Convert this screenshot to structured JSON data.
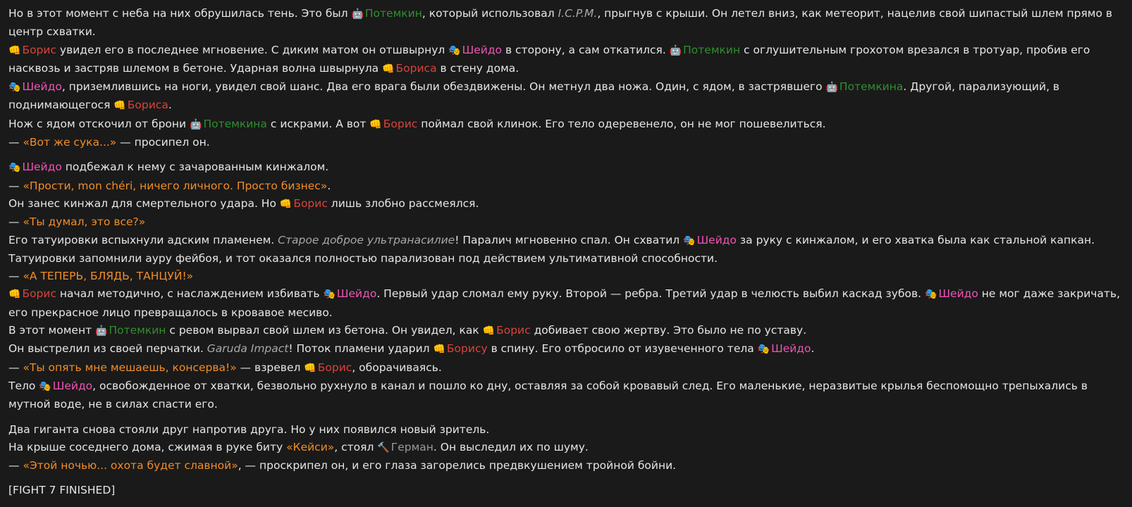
{
  "characters": {
    "potemkin": {
      "icon": "robot-face-icon",
      "emoji": "🤖",
      "color": "#2f8f2f"
    },
    "boris": {
      "icon": "fist-icon",
      "emoji": "👊",
      "color": "#d8433a"
    },
    "sheydo": {
      "icon": "theater-masks-icon",
      "emoji": "🎭",
      "color": "#ee55b4"
    },
    "german": {
      "icon": "hammer-icon",
      "emoji": "🔨",
      "color": "#9a9a9a"
    }
  },
  "quote_color": "#f28c28",
  "paragraphs": [
    {
      "gap": false,
      "segments": [
        {
          "t": "Но в этот момент с неба на них обрушилась тень. Это был "
        },
        {
          "char": "potemkin",
          "name": "Потемкин"
        },
        {
          "t": ", который использовал "
        },
        {
          "it": "I.C.P.M."
        },
        {
          "t": ", прыгнув с крыши. Он летел вниз, как метеорит, нацелив свой шипастый шлем прямо в центр схватки."
        }
      ]
    },
    {
      "gap": false,
      "segments": [
        {
          "char": "boris",
          "name": "Борис"
        },
        {
          "t": " увидел его в последнее мгновение. С диким матом он отшвырнул "
        },
        {
          "char": "sheydo",
          "name": "Шейдо"
        },
        {
          "t": " в сторону, а сам откатился. "
        },
        {
          "char": "potemkin",
          "name": "Потемкин"
        },
        {
          "t": " с оглушительным грохотом врезался в тротуар, пробив его насквозь и застряв шлемом в бетоне. Ударная волна швырнула "
        },
        {
          "char": "boris",
          "name": "Бориса"
        },
        {
          "t": " в стену дома."
        }
      ]
    },
    {
      "gap": false,
      "segments": [
        {
          "char": "sheydo",
          "name": "Шейдо"
        },
        {
          "t": ", приземлившись на ноги, увидел свой шанс. Два его врага были обездвижены. Он метнул два ножа. Один, с ядом, в застрявшего "
        },
        {
          "char": "potemkin",
          "name": "Потемкина"
        },
        {
          "t": ". Другой, парализующий, в поднимающегося "
        },
        {
          "char": "boris",
          "name": "Бориса"
        },
        {
          "t": "."
        }
      ]
    },
    {
      "gap": false,
      "segments": [
        {
          "t": "Нож с ядом отскочил от брони "
        },
        {
          "char": "potemkin",
          "name": "Потемкина"
        },
        {
          "t": " с искрами. А вот "
        },
        {
          "char": "boris",
          "name": "Борис"
        },
        {
          "t": " поймал свой клинок. Его тело одеревенело, он не мог пошевелиться."
        }
      ]
    },
    {
      "gap": false,
      "segments": [
        {
          "t": "— "
        },
        {
          "q": "«Вот же сука...»"
        },
        {
          "t": " — просипел он."
        }
      ]
    },
    {
      "gap": true,
      "segments": [
        {
          "char": "sheydo",
          "name": "Шейдо"
        },
        {
          "t": " подбежал к нему с зачарованным кинжалом."
        }
      ]
    },
    {
      "gap": false,
      "segments": [
        {
          "t": "— "
        },
        {
          "q": "«Прости, mon chéri, ничего личного. Просто бизнес»"
        },
        {
          "t": "."
        }
      ]
    },
    {
      "gap": false,
      "segments": [
        {
          "t": "Он занес кинжал для смертельного удара. Но "
        },
        {
          "char": "boris",
          "name": "Борис"
        },
        {
          "t": " лишь злобно рассмеялся."
        }
      ]
    },
    {
      "gap": false,
      "segments": [
        {
          "t": "— "
        },
        {
          "q": "«Ты думал, это все?»"
        }
      ]
    },
    {
      "gap": false,
      "segments": [
        {
          "t": "Его татуировки вспыхнули адским пламенем. "
        },
        {
          "it": "Старое доброе ультранасилие"
        },
        {
          "t": "! Паралич мгновенно спал. Он схватил "
        },
        {
          "char": "sheydo",
          "name": "Шейдо"
        },
        {
          "t": " за руку с кинжалом, и его хватка была как стальной капкан. Татуировки запомнили ауру фейбоя, и тот оказался полностью парализован под действием ультимативной способности."
        }
      ]
    },
    {
      "gap": false,
      "segments": [
        {
          "t": "— "
        },
        {
          "q": "«А ТЕПЕРЬ, БЛЯДЬ, ТАНЦУЙ!»"
        }
      ]
    },
    {
      "gap": false,
      "segments": [
        {
          "char": "boris",
          "name": "Борис"
        },
        {
          "t": " начал методично, с наслаждением избивать "
        },
        {
          "char": "sheydo",
          "name": "Шейдо"
        },
        {
          "t": ". Первый удар сломал ему руку. Второй — ребра. Третий удар в челюсть выбил каскад зубов. "
        },
        {
          "char": "sheydo",
          "name": "Шейдо"
        },
        {
          "t": " не мог даже закричать, его прекрасное лицо превращалось в кровавое месиво."
        }
      ]
    },
    {
      "gap": false,
      "segments": [
        {
          "t": "В этот момент "
        },
        {
          "char": "potemkin",
          "name": "Потемкин"
        },
        {
          "t": " с ревом вырвал свой шлем из бетона. Он увидел, как "
        },
        {
          "char": "boris",
          "name": "Борис"
        },
        {
          "t": " добивает свою жертву. Это было не по уставу."
        }
      ]
    },
    {
      "gap": false,
      "segments": [
        {
          "t": "Он выстрелил из своей перчатки. "
        },
        {
          "it": "Garuda Impact"
        },
        {
          "t": "! Поток пламени ударил "
        },
        {
          "char": "boris",
          "name": "Борису"
        },
        {
          "t": " в спину. Его отбросило от изувеченного тела "
        },
        {
          "char": "sheydo",
          "name": "Шейдо"
        },
        {
          "t": "."
        }
      ]
    },
    {
      "gap": false,
      "segments": [
        {
          "t": "— "
        },
        {
          "q": "«Ты опять мне мешаешь, консерва!»"
        },
        {
          "t": " — взревел "
        },
        {
          "char": "boris",
          "name": "Борис"
        },
        {
          "t": ", оборачиваясь."
        }
      ]
    },
    {
      "gap": false,
      "segments": [
        {
          "t": "Тело "
        },
        {
          "char": "sheydo",
          "name": "Шейдо"
        },
        {
          "t": ", освобожденное от хватки, безвольно рухнуло в канал и пошло ко дну, оставляя за собой кровавый след. Его маленькие, неразвитые крылья беспомощно трепыхались в мутной воде, не в силах спасти его."
        }
      ]
    },
    {
      "gap": true,
      "segments": [
        {
          "t": "Два гиганта снова стояли друг напротив друга. Но у них появился новый зритель."
        }
      ]
    },
    {
      "gap": false,
      "segments": [
        {
          "t": "На крыше соседнего дома, сжимая в руке биту "
        },
        {
          "q": "«Кейси»"
        },
        {
          "t": ", стоял "
        },
        {
          "char": "german",
          "name": "Герман"
        },
        {
          "t": ". Он выследил их по шуму."
        }
      ]
    },
    {
      "gap": false,
      "segments": [
        {
          "t": "— "
        },
        {
          "q": "«Этой ночью... охота будет славной»"
        },
        {
          "t": ", — проскрипел он, и его глаза загорелись предвкушением тройной бойни."
        }
      ]
    },
    {
      "gap": true,
      "segments": [
        {
          "t": "[FIGHT 7 FINISHED]"
        }
      ]
    }
  ]
}
